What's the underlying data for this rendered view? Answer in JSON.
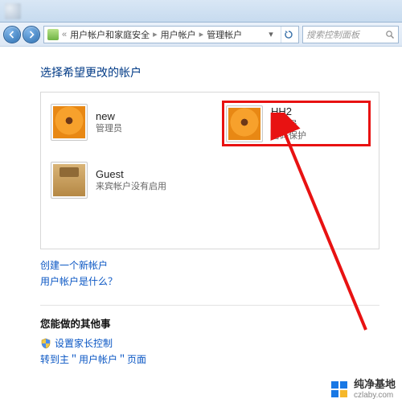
{
  "breadcrumb": {
    "seg1": "用户帐户和家庭安全",
    "seg2": "用户帐户",
    "seg3": "管理帐户"
  },
  "search": {
    "placeholder": "搜索控制面板"
  },
  "heading": "选择希望更改的帐户",
  "accounts": {
    "a1": {
      "name": "new",
      "sub1": "管理员"
    },
    "a2": {
      "name": "HH2",
      "sub1": "管理员",
      "sub2": "密码保护"
    },
    "a3": {
      "name": "Guest",
      "sub1": "来宾帐户没有启用"
    }
  },
  "links": {
    "l1": "创建一个新帐户",
    "l2": "用户帐户是什么？"
  },
  "other": {
    "title": "您能做的其他事",
    "l1": "设置家长控制",
    "l2": "转到主＂用户帐户＂页面"
  },
  "watermark": {
    "main": "纯净基地",
    "sub": "czlaby.com"
  }
}
